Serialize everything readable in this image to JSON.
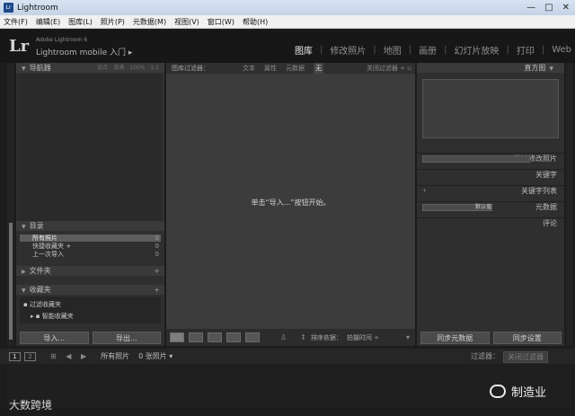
{
  "window": {
    "title": "Lightroom",
    "icon_text": "Lr",
    "min": "—",
    "max": "□",
    "close": "✕"
  },
  "menu": [
    "文件(F)",
    "编辑(E)",
    "图库(L)",
    "照片(P)",
    "元数据(M)",
    "视图(V)",
    "窗口(W)",
    "帮助(H)"
  ],
  "identity": {
    "logo": "Lr",
    "small": "Adobe Lightroom 6",
    "main": "Lightroom mobile 入门  ▸"
  },
  "modules": [
    {
      "label": "图库",
      "active": true
    },
    {
      "label": "修改照片",
      "active": false
    },
    {
      "label": "地图",
      "active": false
    },
    {
      "label": "画册",
      "active": false
    },
    {
      "label": "幻灯片放映",
      "active": false
    },
    {
      "label": "打印",
      "active": false
    },
    {
      "label": "Web",
      "active": false
    }
  ],
  "left": {
    "navigator": "导航器",
    "nav_opts": [
      "适合",
      "填满",
      "100%",
      "1:1"
    ],
    "catalog": "目录",
    "catalog_items": [
      {
        "label": "所有照片",
        "count": "0",
        "selected": true
      },
      {
        "label": "快捷收藏夹 +",
        "count": "0",
        "selected": false
      },
      {
        "label": "上一次导入",
        "count": "0",
        "selected": false
      }
    ],
    "folders": "文件夹",
    "collections": "收藏夹",
    "coll_items": [
      "▪ 过滤收藏夹",
      "▸ ▪ 智能收藏夹"
    ],
    "plus": "+",
    "import_btn": "导入...",
    "export_btn": "导出..."
  },
  "center": {
    "filter_label": "图库过滤器：",
    "filter_tabs": [
      "文本",
      "属性",
      "元数据",
      "无"
    ],
    "filter_preset": "关闭过滤器 ÷ ▫",
    "empty_message": "单击“导入...”按钮开始。",
    "sort_label": "排序依据：",
    "sort_value": "拍摄时间 ÷"
  },
  "right": {
    "histogram": "直方图",
    "quick_develop": "快速修改照片",
    "keywording": "关键字",
    "keyword_list": "关键字列表",
    "metadata": "元数据",
    "metadata_preset": "默认值",
    "comments": "评论",
    "sync_meta": "同步元数据",
    "sync_settings": "同步设置"
  },
  "filmstrip": {
    "num1": "1",
    "num2": "2",
    "nav": "⊞ ◀ ▶",
    "path": "所有照片",
    "count": "0 张照片 ▾",
    "filter_label": "过滤器：",
    "filter_value": "关闭过滤器"
  },
  "watermarks": {
    "left": "大数跨境",
    "right": "制造业"
  }
}
